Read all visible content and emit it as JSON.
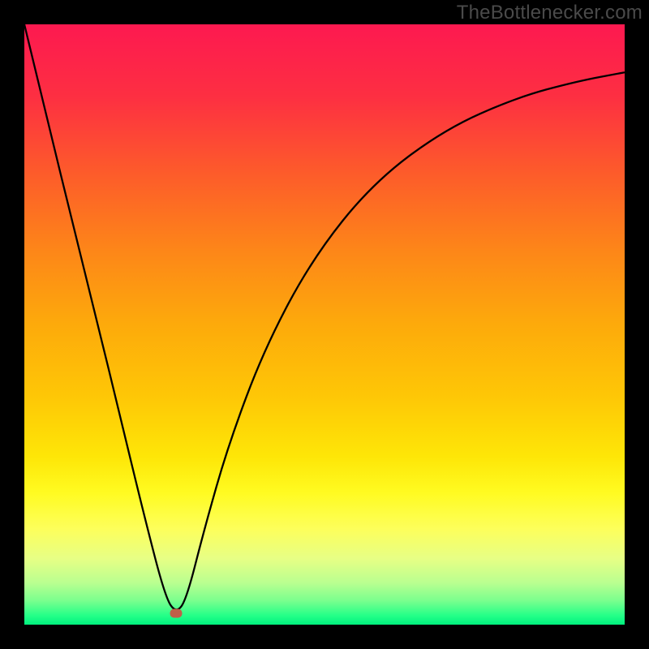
{
  "watermark": "TheBottlenecker.com",
  "gradient": {
    "stops": [
      {
        "offset": 0.0,
        "color": "#fd1950"
      },
      {
        "offset": 0.12,
        "color": "#fd2f42"
      },
      {
        "offset": 0.25,
        "color": "#fd5c2a"
      },
      {
        "offset": 0.38,
        "color": "#fd8718"
      },
      {
        "offset": 0.5,
        "color": "#fdaa0b"
      },
      {
        "offset": 0.62,
        "color": "#fec706"
      },
      {
        "offset": 0.72,
        "color": "#fee607"
      },
      {
        "offset": 0.78,
        "color": "#fffb21"
      },
      {
        "offset": 0.84,
        "color": "#fdff5b"
      },
      {
        "offset": 0.89,
        "color": "#e7ff85"
      },
      {
        "offset": 0.93,
        "color": "#baff90"
      },
      {
        "offset": 0.96,
        "color": "#7aff8e"
      },
      {
        "offset": 0.985,
        "color": "#24ff88"
      },
      {
        "offset": 1.0,
        "color": "#00f07e"
      }
    ]
  },
  "curve_color": "#000000",
  "curve_width": 2.3,
  "marker": {
    "x_frac": 0.253,
    "y_frac": 0.981,
    "color": "#c06048"
  },
  "chart_data": {
    "type": "line",
    "title": "",
    "xlabel": "",
    "ylabel": "",
    "xlim": [
      0,
      100
    ],
    "ylim": [
      0,
      100
    ],
    "series": [
      {
        "name": "bottleneck-curve",
        "x": [
          0,
          4,
          8,
          12,
          16,
          20,
          23.5,
          25.3,
          27,
          30,
          34,
          40,
          48,
          58,
          70,
          82,
          92,
          100
        ],
        "y": [
          100,
          83.5,
          67,
          51,
          34.5,
          18,
          4.5,
          1.9,
          4.2,
          16,
          30,
          46,
          61,
          73.5,
          82.5,
          87.8,
          90.5,
          92
        ]
      }
    ],
    "marker_point": {
      "x": 25.3,
      "y": 1.9
    },
    "background_gradient": "vertical red→orange→yellow→green (top→bottom)"
  }
}
